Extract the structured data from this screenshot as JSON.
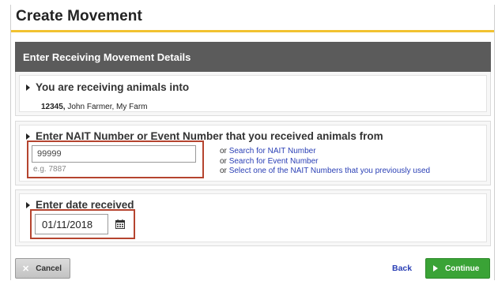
{
  "page": {
    "title": "Create Movement"
  },
  "section": {
    "title": "Enter Receiving Movement Details"
  },
  "receiving": {
    "heading": "You are receiving animals into",
    "farm_id": "12345,",
    "farm_name": " John Farmer, My Farm"
  },
  "source": {
    "heading": "Enter NAIT Number or Event Number that you received animals from",
    "input_value": "99999",
    "hint": "e.g. 7887",
    "or_prefix": "or",
    "links": [
      "Search for NAIT Number",
      "Search for Event Number",
      "Select one of the NAIT Numbers that you previously used"
    ]
  },
  "date": {
    "heading": "Enter date received",
    "value": "01/11/2018",
    "icon": "calendar-icon"
  },
  "footer": {
    "cancel_label": "Cancel",
    "back_label": "Back",
    "continue_label": "Continue"
  },
  "colors": {
    "accent_rule": "#f2c230",
    "header_bg": "#5b5b5b",
    "highlight": "#b5442f",
    "link": "#2a3fb5",
    "continue": "#3aa336"
  }
}
